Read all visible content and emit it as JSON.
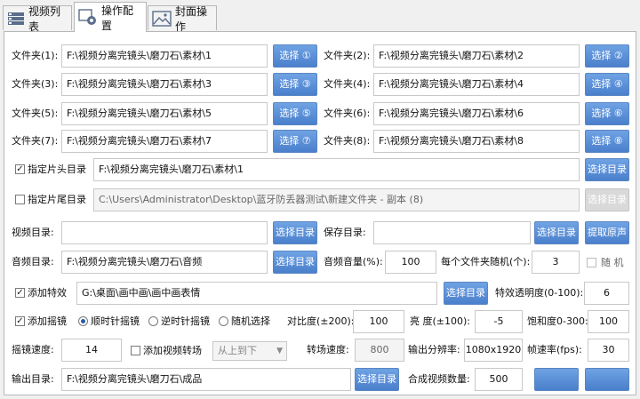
{
  "tabs": [
    {
      "label": "视频列表",
      "icon": "list-icon"
    },
    {
      "label": "操作配置",
      "icon": "gear-icon"
    },
    {
      "label": "封面操作",
      "icon": "image-icon"
    }
  ],
  "folders": [
    {
      "label": "文件夹(1):",
      "value": "F:\\视频分离完镜头\\磨刀石\\素材\\1",
      "button": "选择 ①"
    },
    {
      "label": "文件夹(2):",
      "value": "F:\\视频分离完镜头\\磨刀石\\素材\\2",
      "button": "选择 ②"
    },
    {
      "label": "文件夹(3):",
      "value": "F:\\视频分离完镜头\\磨刀石\\素材\\3",
      "button": "选择 ③"
    },
    {
      "label": "文件夹(4):",
      "value": "F:\\视频分离完镜头\\磨刀石\\素材\\4",
      "button": "选择 ④"
    },
    {
      "label": "文件夹(5):",
      "value": "F:\\视频分离完镜头\\磨刀石\\素材\\5",
      "button": "选择 ⑤"
    },
    {
      "label": "文件夹(6):",
      "value": "F:\\视频分离完镜头\\磨刀石\\素材\\6",
      "button": "选择 ⑥"
    },
    {
      "label": "文件夹(7):",
      "value": "F:\\视频分离完镜头\\磨刀石\\素材\\7",
      "button": "选择 ⑦"
    },
    {
      "label": "文件夹(8):",
      "value": "F:\\视频分离完镜头\\磨刀石\\素材\\8",
      "button": "选择 ⑧"
    }
  ],
  "intro": {
    "label": "指定片头目录",
    "checked": true,
    "value": "F:\\视频分离完镜头\\磨刀石\\素材\\1",
    "button": "选择目录"
  },
  "outro": {
    "label": "指定片尾目录",
    "checked": false,
    "value": "C:\\Users\\Administrator\\Desktop\\蓝牙防丢器测试\\新建文件夹 - 副本 (8)",
    "button": "选择目录"
  },
  "video_dir": {
    "label": "视频目录:",
    "value": "",
    "button": "选择目录"
  },
  "save_dir": {
    "label": "保存目录:",
    "value": "",
    "button": "选择目录",
    "extract_button": "提取原声"
  },
  "audio": {
    "label": "音频目录:",
    "value": "F:\\视频分离完镜头\\磨刀石\\音频",
    "button": "选择目录",
    "volume_label": "音频音量(%):",
    "volume": "100",
    "per_folder_label": "每个文件夹随机(个):",
    "per_folder": "3",
    "random_label": "随 机",
    "random_checked": false
  },
  "effects": {
    "label": "添加特效",
    "checked": true,
    "value": "G:\\桌面\\画中画\\画中画表情",
    "button": "选择目录",
    "opacity_label": "特效透明度(0-100):",
    "opacity": "6"
  },
  "shake": {
    "label": "添加摇镜",
    "checked": true,
    "options": [
      "顺时针摇镜",
      "逆时针摇镜",
      "随机选择"
    ],
    "selected": 0,
    "contrast_label": "对比度(±200):",
    "contrast": "100",
    "brightness_label": "亮  度(±100):",
    "brightness": "-5",
    "saturation_label": "饱和度0-300:",
    "saturation": "100"
  },
  "speed": {
    "label": "摇镜速度:",
    "value": "14",
    "transition_label": "添加视频转场",
    "transition_checked": false,
    "transition_select": "从上到下",
    "transition_speed_label": "转场速度:",
    "transition_speed": "800",
    "resolution_label": "输出分辨率:",
    "resolution": "1080x1920",
    "fps_label": "帧速率(fps):",
    "fps": "30"
  },
  "output": {
    "label": "输出目录:",
    "value": "F:\\视频分离完镜头\\磨刀石\\成品",
    "button": "选择目录",
    "count_label": "合成视频数量:",
    "count": "500"
  },
  "colors": {
    "accent": "#4a7fcc",
    "accent_light": "#6fa3e3",
    "disabled": "#d9d9d9"
  }
}
